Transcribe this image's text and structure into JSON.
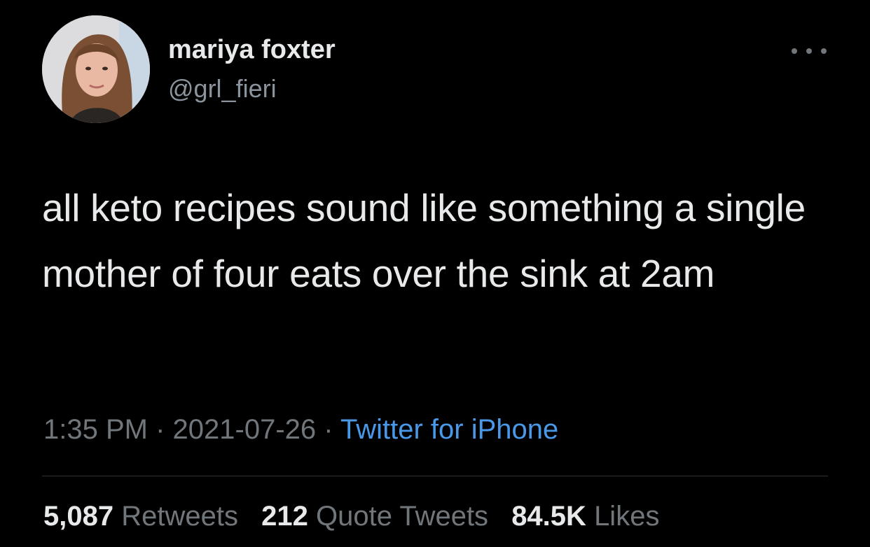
{
  "author": {
    "display_name": "mariya foxter",
    "handle": "@grl_fieri",
    "avatar_icon": "profile-photo"
  },
  "more_icon": "more-horizontal-icon",
  "tweet": {
    "text": "all keto recipes sound like something a single mother of four eats over the sink at 2am"
  },
  "meta": {
    "time": "1:35 PM",
    "separator": "·",
    "date": "2021-07-26",
    "source": "Twitter for iPhone"
  },
  "stats": {
    "retweets": {
      "count": "5,087",
      "label": "Retweets"
    },
    "quote_tweets": {
      "count": "212",
      "label": "Quote Tweets"
    },
    "likes": {
      "count": "84.5K",
      "label": "Likes"
    }
  },
  "colors": {
    "background": "#000000",
    "text": "#e7e9ea",
    "secondary": "#71767b",
    "link": "#4a99e9",
    "divider": "#2f3336"
  }
}
